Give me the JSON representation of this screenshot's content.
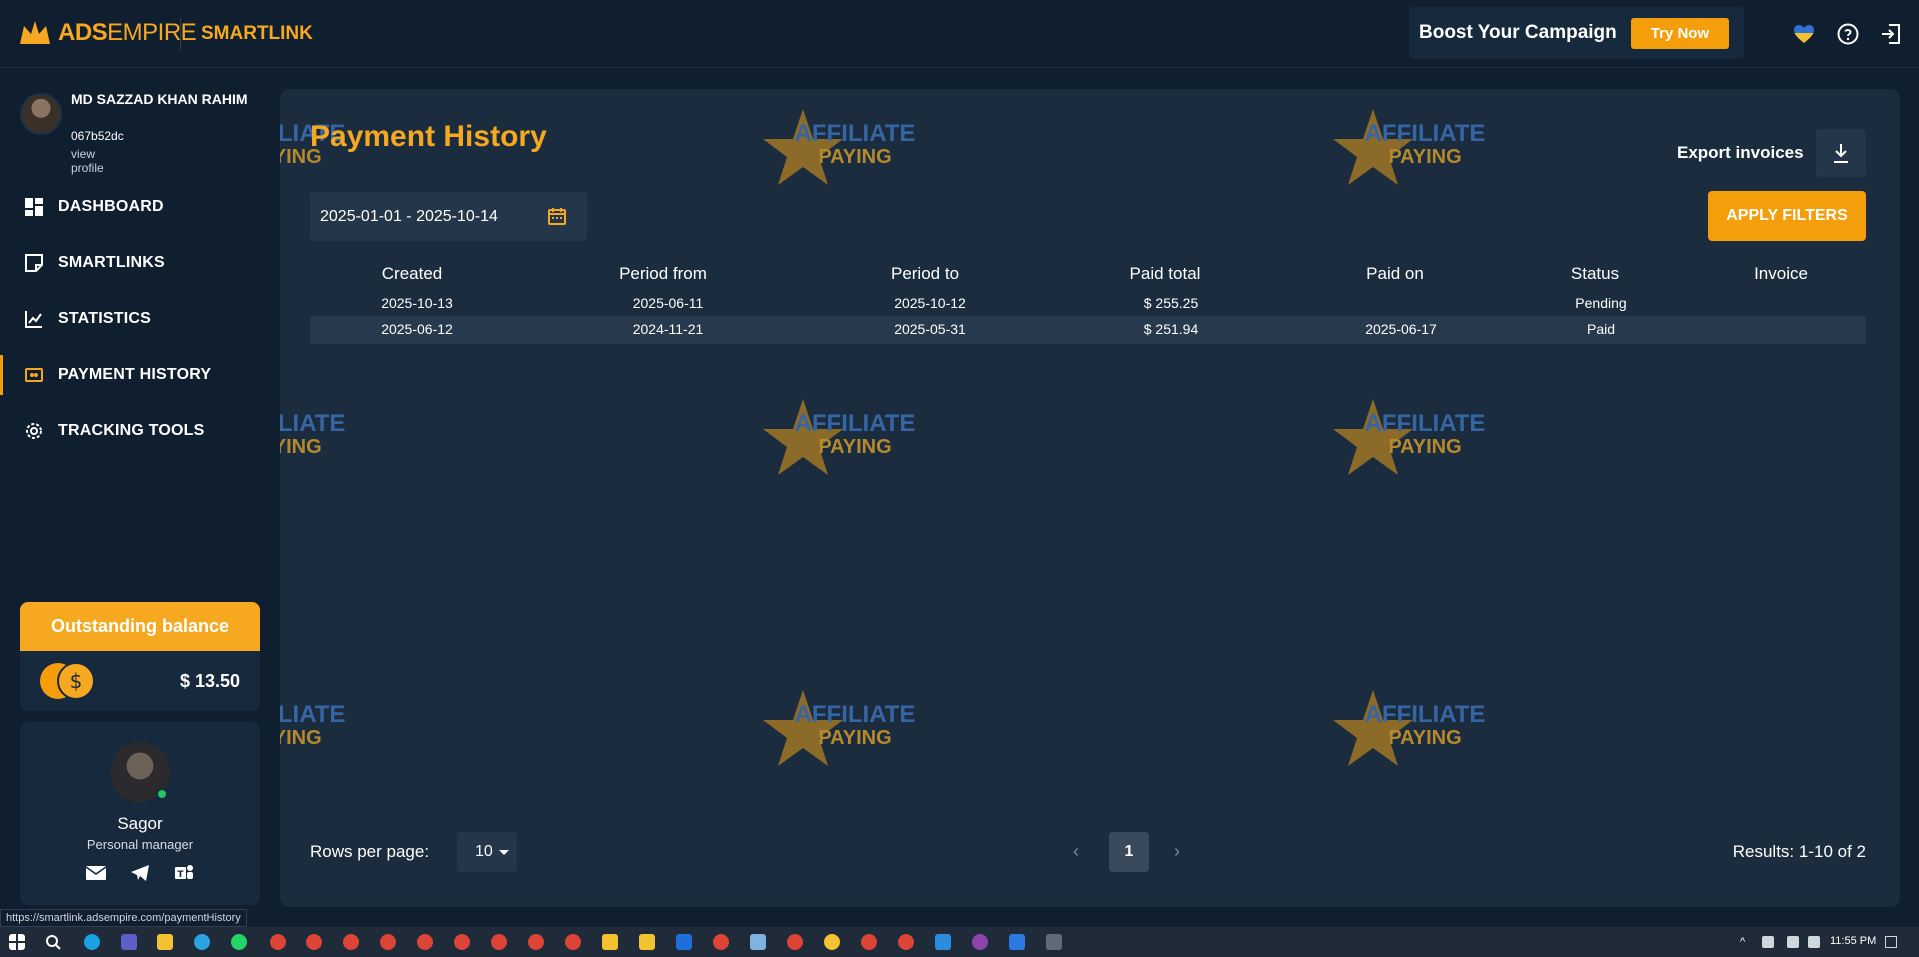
{
  "header": {
    "brand_bold": "ADS",
    "brand_rest": "EMPIRE",
    "product": "SMARTLINK",
    "boost_text": "Boost Your Campaign",
    "try_label": "Try Now"
  },
  "profile": {
    "name": "MD SAZZAD KHAN RAHIM",
    "id": "067b52dc",
    "link": "view profile"
  },
  "nav": [
    {
      "label": "DASHBOARD",
      "icon": "dashboard-icon"
    },
    {
      "label": "SMARTLINKS",
      "icon": "smartlinks-icon"
    },
    {
      "label": "STATISTICS",
      "icon": "statistics-icon"
    },
    {
      "label": "PAYMENT HISTORY",
      "icon": "payment-icon",
      "active": true
    },
    {
      "label": "TRACKING TOOLS",
      "icon": "gear-icon"
    }
  ],
  "balance": {
    "title": "Outstanding balance",
    "value": "$ 13.50"
  },
  "manager": {
    "name": "Sagor",
    "role": "Personal manager"
  },
  "page": {
    "title": "Payment History",
    "export_label": "Export invoices",
    "date_range": "2025-01-01 - 2025-10-14",
    "apply_label": "APPLY FILTERS"
  },
  "table": {
    "columns": [
      "Created",
      "Period from",
      "Period to",
      "Paid total",
      "Paid on",
      "Status",
      "Invoice"
    ],
    "rows": [
      [
        "2025-10-13",
        "2025-06-11",
        "2025-10-12",
        "$ 255.25",
        "",
        "Pending",
        ""
      ],
      [
        "2025-06-12",
        "2024-11-21",
        "2025-05-31",
        "$ 251.94",
        "2025-06-17",
        "Paid",
        ""
      ]
    ]
  },
  "pagination": {
    "rows_label": "Rows per page:",
    "rows_value": "10",
    "prev": "‹",
    "current": "1",
    "next": "›",
    "results": "Results: 1-10 of 2"
  },
  "watermark_text": [
    "AFFILIATE",
    "PAYING"
  ],
  "status_url": "https://smartlink.adsempire.com/paymentHistory",
  "taskbar": {
    "time": "11:55 PM"
  },
  "colors": {
    "accent": "#f6a821",
    "background": "#0f1f30",
    "card": "#1b2c3e",
    "online": "#22c55e"
  }
}
